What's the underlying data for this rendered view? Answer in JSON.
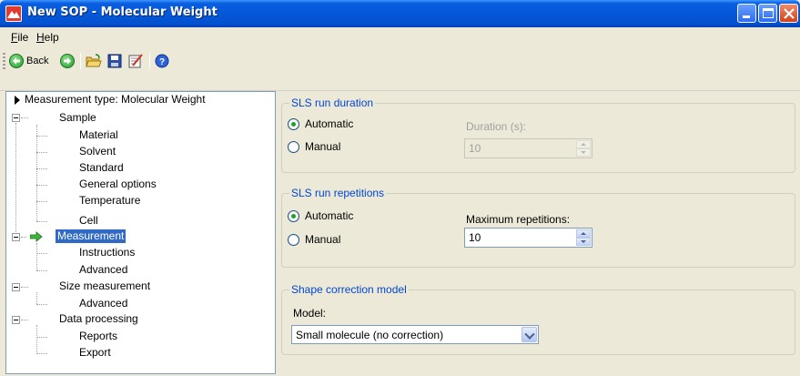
{
  "window": {
    "title": "New SOP - Molecular Weight",
    "icons": {
      "app": "mountain-icon",
      "minimize": "minimize-icon",
      "maximize": "maximize-icon",
      "close": "close-icon"
    }
  },
  "menu": {
    "file": {
      "underline": "F",
      "rest": "ile"
    },
    "help": {
      "underline": "H",
      "rest": "elp"
    }
  },
  "toolbar": {
    "back_label": "Back",
    "icons": [
      "back-arrow-icon",
      "forward-arrow-icon",
      "open-folder-icon",
      "save-disk-icon",
      "edit-check-icon",
      "help-icon"
    ]
  },
  "tree": {
    "root": "Measurement type: Molecular Weight",
    "sample": "Sample",
    "sample_children": [
      "Material",
      "Solvent",
      "Standard",
      "General options",
      "Temperature",
      "Cell"
    ],
    "measurement": "Measurement",
    "measurement_children": [
      "Instructions",
      "Advanced"
    ],
    "size_measurement": "Size measurement",
    "size_children": [
      "Advanced"
    ],
    "data_processing": "Data processing",
    "data_children": [
      "Reports",
      "Export"
    ]
  },
  "duration_group": {
    "title": "SLS run duration",
    "automatic": "Automatic",
    "manual": "Manual",
    "field_label": "Duration (s):",
    "field_value": "10",
    "selected": "Automatic"
  },
  "repetitions_group": {
    "title": "SLS run repetitions",
    "automatic": "Automatic",
    "manual": "Manual",
    "field_label": "Maximum repetitions:",
    "field_value": "10",
    "selected": "Automatic"
  },
  "shape_group": {
    "title": "Shape correction model",
    "model_label": "Model:",
    "model_value": "Small molecule (no correction)"
  },
  "colors": {
    "titlebar": "#0458d8",
    "group_title": "#0046d5",
    "selection": "#316ac5",
    "radio_dot": "#21a121"
  }
}
